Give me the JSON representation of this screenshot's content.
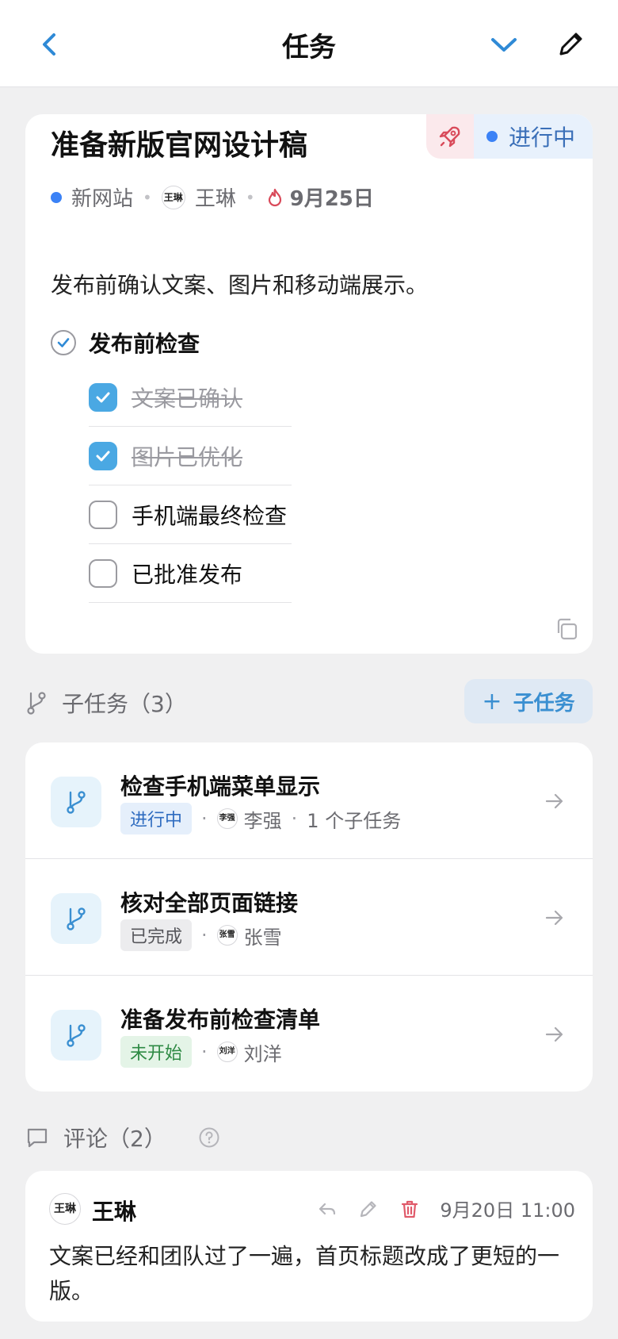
{
  "header": {
    "title": "任务"
  },
  "task": {
    "title": "准备新版官网设计稿",
    "status": "进行中",
    "project": "新网站",
    "assignee": "王琳",
    "assignee_avatar": "王琳",
    "due": "9月25日",
    "description": "发布前确认文案、图片和移动端展示。",
    "checklist_title": "发布前检查",
    "checklist": [
      {
        "label": "文案已确认",
        "done": true
      },
      {
        "label": "图片已优化",
        "done": true
      },
      {
        "label": "手机端最终检查",
        "done": false
      },
      {
        "label": "已批准发布",
        "done": false
      }
    ]
  },
  "subtasks": {
    "heading": "子任务（3）",
    "add_label": "子任务",
    "items": [
      {
        "title": "检查手机端菜单显示",
        "status": "进行中",
        "assignee": "李强",
        "avatar": "李强",
        "extra": "1 个子任务"
      },
      {
        "title": "核对全部页面链接",
        "status": "已完成",
        "assignee": "张雪",
        "avatar": "张雪"
      },
      {
        "title": "准备发布前检查清单",
        "status": "未开始",
        "assignee": "刘洋",
        "avatar": "刘洋"
      }
    ]
  },
  "comments": {
    "heading": "评论（2）",
    "items": [
      {
        "author": "王琳",
        "avatar": "王琳",
        "time": "9月20日 11:00",
        "body": "文案已经和团队过了一遍，首页标题改成了更短的一版。"
      }
    ]
  },
  "colors": {
    "accent": "#3a8fd1",
    "checkbox": "#4aa8e3",
    "status_blue": "#3b82f6",
    "danger": "#e05a6a"
  }
}
